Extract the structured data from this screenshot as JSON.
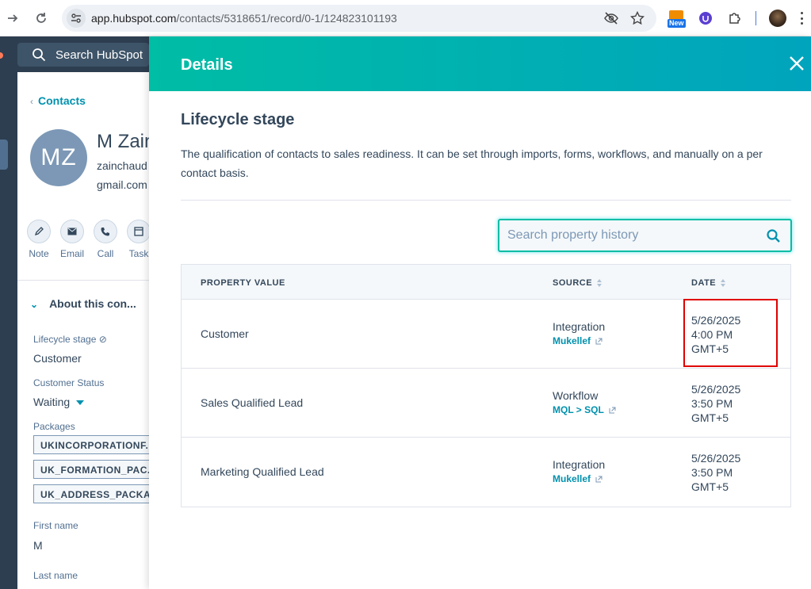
{
  "browser": {
    "url_host": "app.hubspot.com",
    "url_path": "/contacts/5318651/record/0-1/124823101193",
    "ext_badge": "New",
    "icons": [
      "forward-icon",
      "reload-icon",
      "site-info-icon",
      "eye-off-icon",
      "star-icon",
      "extension-new-icon",
      "extension-icon",
      "puzzle-icon",
      "profile-avatar",
      "menu-icon"
    ]
  },
  "hubspot": {
    "search_label": "Search HubSpot",
    "back_label": "Contacts",
    "contact": {
      "initials": "MZ",
      "name": "M Zain",
      "email_line1": "zainchaud",
      "email_line2": "gmail.com"
    },
    "actions": [
      {
        "label": "Note",
        "icon": "note-icon"
      },
      {
        "label": "Email",
        "icon": "email-icon"
      },
      {
        "label": "Call",
        "icon": "call-icon"
      },
      {
        "label": "Task",
        "icon": "task-icon"
      }
    ],
    "about_title": "About this con...",
    "properties": {
      "lifecycle_label": "Lifecycle stage",
      "lifecycle_value": "Customer",
      "status_label": "Customer Status",
      "status_value": "Waiting",
      "packages_label": "Packages",
      "packages": [
        "UKINCORPORATIONF...",
        "UK_FORMATION_PAC...",
        "UK_ADDRESS_PACKAG"
      ],
      "first_name_label": "First name",
      "first_name_value": "M",
      "last_name_label": "Last name"
    }
  },
  "details": {
    "title": "Details",
    "section_title": "Lifecycle stage",
    "description": "The qualification of contacts to sales readiness. It can be set through imports, forms, workflows, and manually on a per contact basis.",
    "search_placeholder": "Search property history",
    "columns": {
      "value": "PROPERTY VALUE",
      "source": "SOURCE",
      "date": "DATE"
    },
    "rows": [
      {
        "value": "Customer",
        "source": "Integration",
        "source_link": "Mukellef",
        "date": "5/26/2025",
        "time": "4:00 PM",
        "tz": "GMT+5"
      },
      {
        "value": "Sales Qualified Lead",
        "source": "Workflow",
        "source_link": "MQL > SQL",
        "date": "5/26/2025",
        "time": "3:50 PM",
        "tz": "GMT+5"
      },
      {
        "value": "Marketing Qualified Lead",
        "source": "Integration",
        "source_link": "Mukellef",
        "date": "5/26/2025",
        "time": "3:50 PM",
        "tz": "GMT+5"
      }
    ],
    "colors": {
      "header_gradient_start": "#00bda5",
      "header_gradient_end": "#00a4bd",
      "link": "#0091ae",
      "highlight": "#e00000"
    }
  }
}
